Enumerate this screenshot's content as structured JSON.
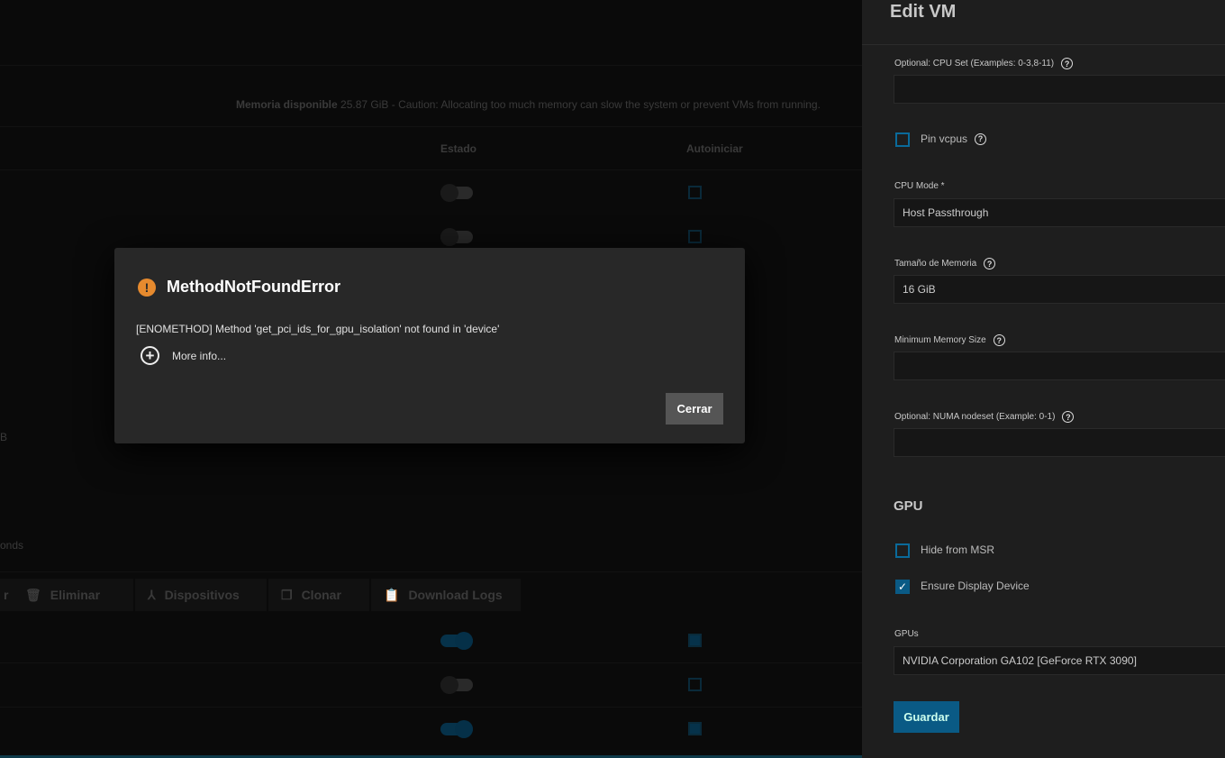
{
  "background": {
    "memory_label": "Memoria disponible",
    "memory_text": "25.87 GiB - Caution: Allocating too much memory can slow the system or prevent VMs from running.",
    "col_estado": "Estado",
    "col_autoiniciar": "Autoiniciar",
    "fragment_b": "B",
    "fragment_onds": "onds",
    "actions": [
      {
        "label": "r",
        "icon": "stop-icon"
      },
      {
        "label": "Eliminar",
        "icon": "trash-icon"
      },
      {
        "label": "Dispositivos",
        "icon": "devices-icon"
      },
      {
        "label": "Clonar",
        "icon": "copy-icon"
      },
      {
        "label": "Download Logs",
        "icon": "clipboard-icon"
      }
    ],
    "rows": [
      {
        "state_on": false,
        "autostart": false
      },
      {
        "state_on": false,
        "autostart": false
      },
      {
        "state_on": true,
        "autostart": true
      },
      {
        "state_on": false,
        "autostart": false
      },
      {
        "state_on": true,
        "autostart": true
      }
    ]
  },
  "panel": {
    "title": "Edit VM",
    "cpu_set_label": "Optional: CPU Set (Examples: 0-3,8-11)",
    "cpu_set_value": "",
    "pin_vcpus_label": "Pin vcpus",
    "pin_vcpus_checked": false,
    "cpu_mode_label": "CPU Mode *",
    "cpu_mode_value": "Host Passthrough",
    "memory_label": "Tamaño de Memoria",
    "memory_value": "16 GiB",
    "min_memory_label": "Minimum Memory Size",
    "min_memory_value": "",
    "numa_label": "Optional: NUMA nodeset (Example: 0-1)",
    "numa_value": "",
    "gpu_heading": "GPU",
    "hide_msr_label": "Hide from MSR",
    "hide_msr_checked": false,
    "ensure_display_label": "Ensure Display Device",
    "ensure_display_checked": true,
    "gpus_label": "GPUs",
    "gpus_value": "NVIDIA Corporation GA102 [GeForce RTX 3090]",
    "save_label": "Guardar"
  },
  "dialog": {
    "title": "MethodNotFoundError",
    "message": "[ENOMETHOD] Method 'get_pci_ids_for_gpu_isolation' not found in 'device'",
    "more_info": "More info...",
    "close_label": "Cerrar",
    "icon_color": "#e68a2e"
  },
  "colors": {
    "accent": "#0a6a9a",
    "save_bg": "#0a5a85"
  }
}
